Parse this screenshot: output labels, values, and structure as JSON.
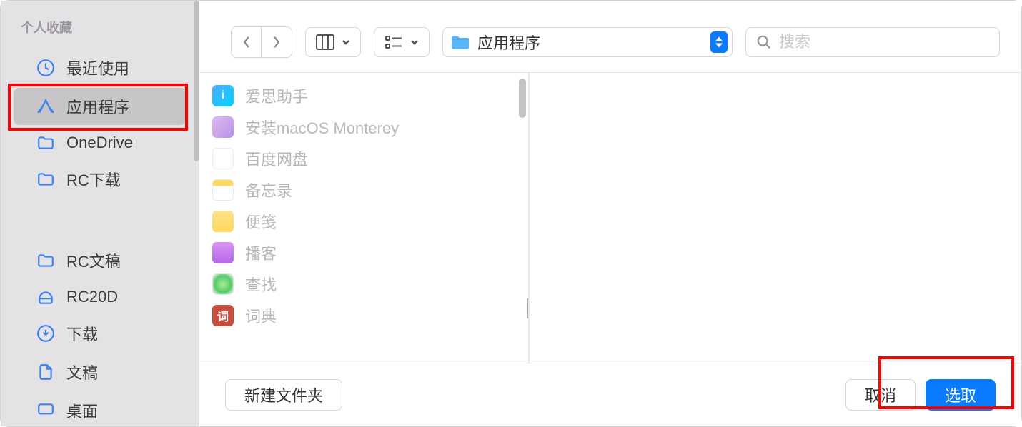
{
  "sidebar": {
    "section_title": "个人收藏",
    "items": [
      {
        "label": "最近使用",
        "icon": "clock",
        "selected": false
      },
      {
        "label": "应用程序",
        "icon": "apps",
        "selected": true
      },
      {
        "label": "OneDrive",
        "icon": "folder",
        "selected": false
      },
      {
        "label": "RC下载",
        "icon": "folder",
        "selected": false
      }
    ],
    "items2": [
      {
        "label": "RC文稿",
        "icon": "folder"
      },
      {
        "label": "RC20D",
        "icon": "disk"
      },
      {
        "label": "下载",
        "icon": "download"
      },
      {
        "label": "文稿",
        "icon": "document"
      },
      {
        "label": "桌面",
        "icon": "desktop"
      }
    ]
  },
  "toolbar": {
    "location_label": "应用程序",
    "search_placeholder": "搜索"
  },
  "files": [
    {
      "label": "爱思助手",
      "icon_class": "icon-i3",
      "glyph": "i"
    },
    {
      "label": "安装macOS Monterey",
      "icon_class": "icon-monterey",
      "glyph": ""
    },
    {
      "label": "百度网盘",
      "icon_class": "icon-baidu",
      "glyph": ""
    },
    {
      "label": "备忘录",
      "icon_class": "icon-notes",
      "glyph": ""
    },
    {
      "label": "便笺",
      "icon_class": "icon-stickies",
      "glyph": ""
    },
    {
      "label": "播客",
      "icon_class": "icon-podcast",
      "glyph": ""
    },
    {
      "label": "查找",
      "icon_class": "icon-findmy",
      "glyph": ""
    },
    {
      "label": "词典",
      "icon_class": "icon-dict",
      "glyph": "词"
    }
  ],
  "buttons": {
    "new_folder": "新建文件夹",
    "cancel": "取消",
    "select": "选取"
  },
  "colors": {
    "accent": "#0a7aff",
    "sidebar_icon": "#3b82f6"
  }
}
